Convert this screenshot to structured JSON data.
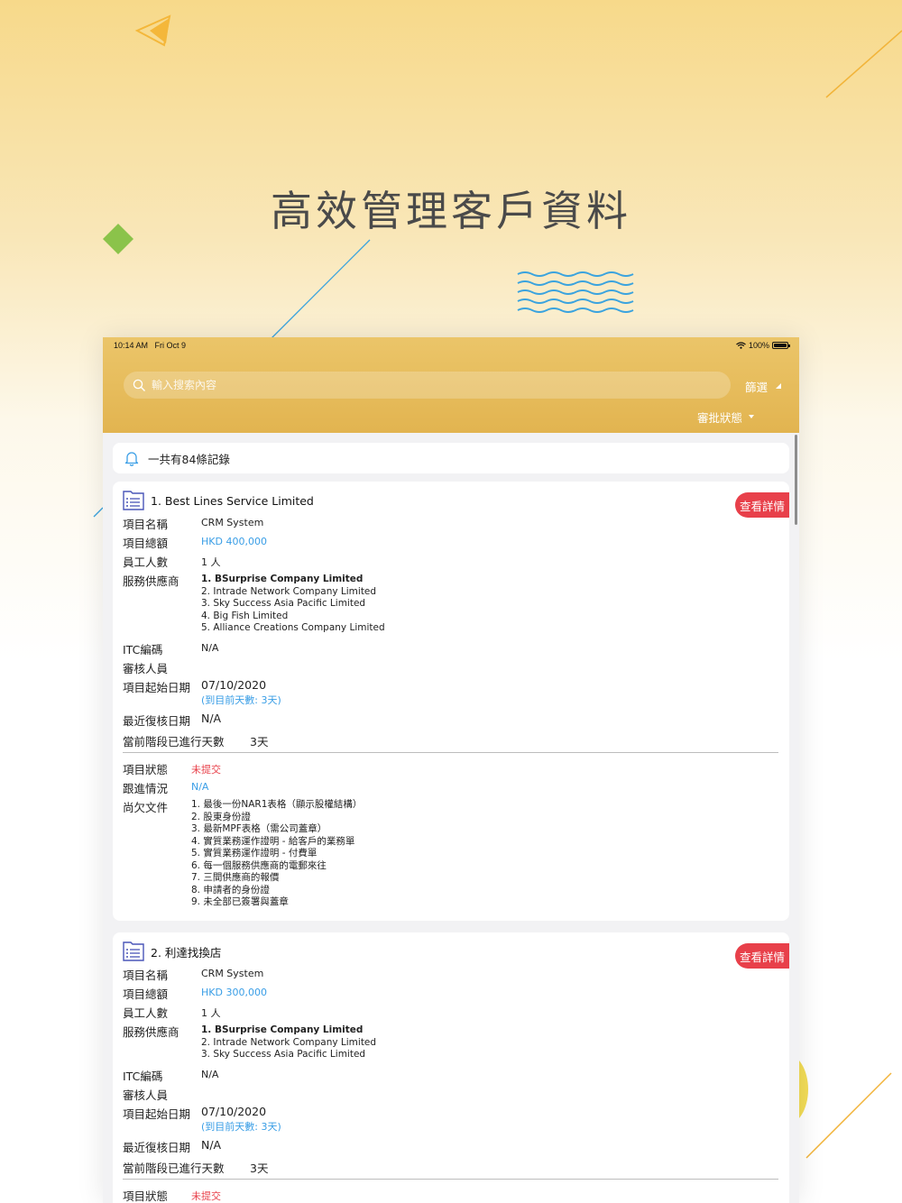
{
  "headline": "高效管理客戶資料",
  "status_bar": {
    "time": "10:14 AM",
    "date": "Fri Oct 9",
    "battery": "100%"
  },
  "search": {
    "placeholder": "輸入搜索內容"
  },
  "filter_label": "篩選",
  "approval_label": "審批狀態",
  "summary": "一共有84條記錄",
  "detail_button": "查看詳情",
  "labels": {
    "project_name": "項目名稱",
    "project_total": "項目總額",
    "staff_count": "員工人數",
    "providers": "服務供應商",
    "itc_code": "ITC編碼",
    "reviewer": "審核人員",
    "start_date": "項目起始日期",
    "last_review": "最近復核日期",
    "stage_days": "當前階段已進行天數",
    "status": "項目狀態",
    "follow_up": "跟進情況",
    "missing_docs": "尚欠文件"
  },
  "records": [
    {
      "title": "1. Best Lines Service Limited",
      "project_name": "CRM System",
      "project_total": "HKD 400,000",
      "staff_count": "1 人",
      "providers": [
        "1. BSurprise Company Limited",
        "2. Intrade Network Company Limited",
        "3. Sky Success Asia Pacific Limited",
        "4. Big Fish Limited",
        "5. Alliance Creations Company Limited"
      ],
      "itc_code": "N/A",
      "start_date": "07/10/2020",
      "days_note": "(到目前天數: 3天)",
      "last_review": "N/A",
      "stage_days": "3天",
      "status": "未提交",
      "follow_up": "N/A",
      "missing_docs": [
        "1. 最後一份NAR1表格（顯示股權結構）",
        "2. 股東身份證",
        "3. 最新MPF表格（需公司蓋章）",
        "4. 實質業務運作證明 - 給客戶的業務單",
        "5. 實質業務運作證明 - 付費單",
        "6. 每一個服務供應商的電郵來往",
        "7. 三間供應商的報價",
        "8. 申請者的身份證",
        "9. 未全部已簽署與蓋章"
      ]
    },
    {
      "title": "2. 利達找換店",
      "project_name": "CRM System",
      "project_total": "HKD 300,000",
      "staff_count": "1 人",
      "providers": [
        "1. BSurprise Company Limited",
        "2. Intrade Network Company Limited",
        "3. Sky Success Asia Pacific Limited"
      ],
      "itc_code": "N/A",
      "start_date": "07/10/2020",
      "days_note": "(到目前天數: 3天)",
      "last_review": "N/A",
      "stage_days": "3天",
      "status": "未提交"
    }
  ],
  "colors": {
    "header": "#e6bd5e",
    "accent_red": "#e8404a",
    "link_blue": "#3a9ee6",
    "icon_purple": "#4a56b8"
  }
}
